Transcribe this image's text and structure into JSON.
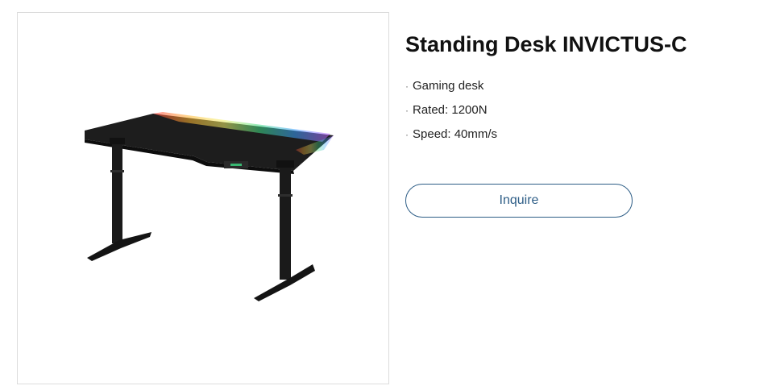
{
  "product": {
    "title": "Standing Desk INVICTUS-C",
    "image_alt_icon": "standing-desk-image",
    "features": [
      {
        "bullet": "·",
        "text": "Gaming desk"
      },
      {
        "bullet": "·",
        "text": "Rated: 1200N"
      },
      {
        "bullet": "·",
        "text": "Speed: 40mm/s"
      }
    ],
    "inquire_label": "Inquire"
  },
  "colors": {
    "accent": "#2d5d86",
    "frame_border": "#dcdcdc",
    "desk": "#1c1c1c"
  }
}
